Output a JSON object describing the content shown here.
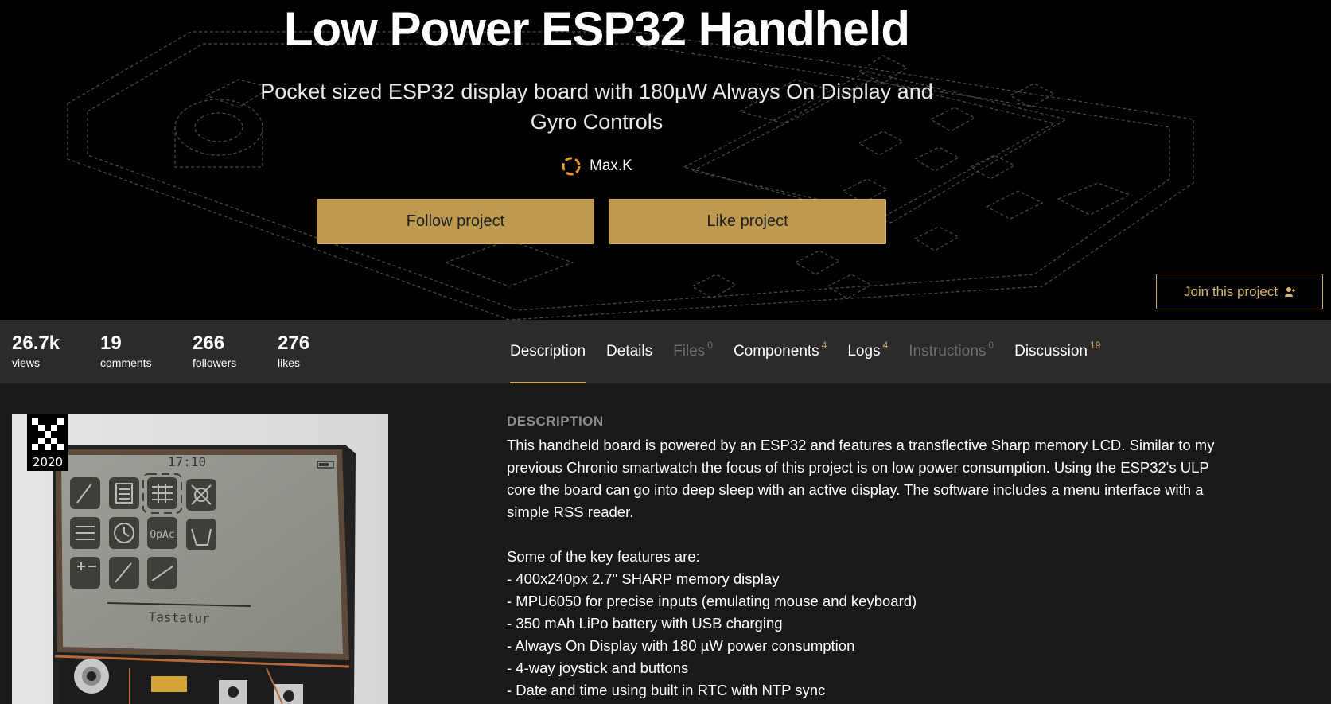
{
  "hero": {
    "title": "Low Power ESP32 Handheld",
    "subtitle": "Pocket sized ESP32 display board with 180µW Always On Display and Gyro Controls",
    "author": "Max.K",
    "follow_label": "Follow project",
    "like_label": "Like project",
    "join_label": "Join this project"
  },
  "stats": [
    {
      "value": "26.7k",
      "label": "views"
    },
    {
      "value": "19",
      "label": "comments"
    },
    {
      "value": "266",
      "label": "followers"
    },
    {
      "value": "276",
      "label": "likes"
    }
  ],
  "tabs": [
    {
      "label": "Description",
      "count": "",
      "active": true,
      "disabled": false
    },
    {
      "label": "Details",
      "count": "",
      "active": false,
      "disabled": false
    },
    {
      "label": "Files",
      "count": "0",
      "active": false,
      "disabled": true
    },
    {
      "label": "Components",
      "count": "4",
      "active": false,
      "disabled": false
    },
    {
      "label": "Logs",
      "count": "4",
      "active": false,
      "disabled": false
    },
    {
      "label": "Instructions",
      "count": "0",
      "active": false,
      "disabled": true
    },
    {
      "label": "Discussion",
      "count": "19",
      "active": false,
      "disabled": false
    }
  ],
  "badge": {
    "year": "2020"
  },
  "device_screen": {
    "time": "17:10",
    "caption": "Tastatur"
  },
  "description": {
    "heading": "DESCRIPTION",
    "paragraph": "This handheld board is powered by an ESP32 and features a transflective Sharp memory LCD. Similar to my previous Chronio smartwatch the focus of this project is on low power consumption. Using the ESP32's ULP core the board can go into deep sleep with an active display. The software includes a menu interface with a simple RSS reader.",
    "features_intro": "Some of the key features are:",
    "features": [
      "- 400x240px 2.7\" SHARP memory display",
      "- MPU6050 for precise inputs (emulating mouse and keyboard)",
      "- 350 mAh LiPo battery with USB charging",
      "- Always On Display with 180 µW power consumption",
      "- 4-way joystick and buttons",
      "- Date and time using built in RTC with NTP sync"
    ]
  },
  "colors": {
    "accent": "#c9a45c",
    "button": "#bd9a4f",
    "bar": "#2b2b2b",
    "background": "#191919"
  }
}
